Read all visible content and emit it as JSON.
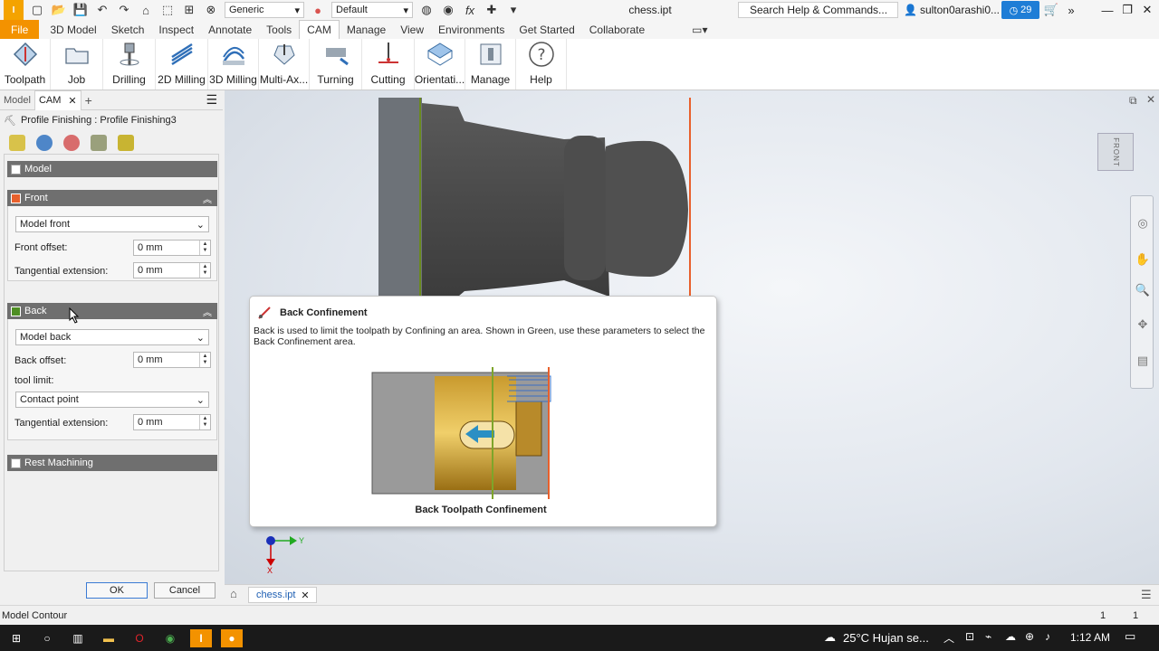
{
  "titlebar": {
    "app_logo": "I",
    "material": "Generic",
    "appearance": "Default",
    "doc_title": "chess.ipt",
    "search_placeholder": "Search Help & Commands...",
    "user": "sulton0arashi0...",
    "notifications": "29"
  },
  "menu": [
    "File",
    "3D Model",
    "Sketch",
    "Inspect",
    "Annotate",
    "Tools",
    "CAM",
    "Manage",
    "View",
    "Environments",
    "Get Started",
    "Collaborate"
  ],
  "ribbon": {
    "toolpath": "Toolpath",
    "job": "Job",
    "drilling": "Drilling",
    "milling2d": "2D Milling",
    "milling3d": "3D Milling",
    "multiaxis": "Multi-Ax...",
    "turning": "Turning",
    "cutting": "Cutting",
    "orientation": "Orientati...",
    "manage": "Manage",
    "help": "Help"
  },
  "panel": {
    "tab_model": "Model",
    "tab_cam": "CAM",
    "close": "✕",
    "add": "+",
    "op_title": "Profile Finishing : Profile Finishing3"
  },
  "form": {
    "model_label": "Model",
    "front_label": "Front",
    "front_select": "Model front",
    "front_offset_label": "Front offset:",
    "front_offset_value": "0 mm",
    "front_tangential_label": "Tangential extension:",
    "front_tangential_value": "0 mm",
    "back_label": "Back",
    "back_select": "Model back",
    "back_offset_label": "Back offset:",
    "back_offset_value": "0 mm",
    "tool_limit_label": "tool limit:",
    "tool_limit_select": "Contact point",
    "back_tangential_label": "Tangential extension:",
    "back_tangential_value": "0 mm",
    "rest_label": "Rest Machining",
    "ok": "OK",
    "cancel": "Cancel"
  },
  "tooltip": {
    "title": "Back Confinement",
    "text": "Back is used to limit the toolpath by Confining an area. Shown in Green, use these parameters to select the Back Confinement area.",
    "caption": "Back Toolpath Confinement"
  },
  "viewport": {
    "viewcube_label": "FRONT",
    "axis_y": "Y",
    "axis_x": "X"
  },
  "doc_tab": "chess.ipt",
  "status": {
    "left": "Model Contour",
    "count1": "1",
    "count2": "1"
  },
  "taskbar": {
    "weather": "25°C  Hujan se...",
    "time": "1:12 AM"
  },
  "colors": {
    "file_tab": "#f39200",
    "section_header": "#6f6f6f",
    "front_marker": "#e8602c",
    "back_marker": "#4e8e23",
    "notification": "#1e7dd6"
  }
}
